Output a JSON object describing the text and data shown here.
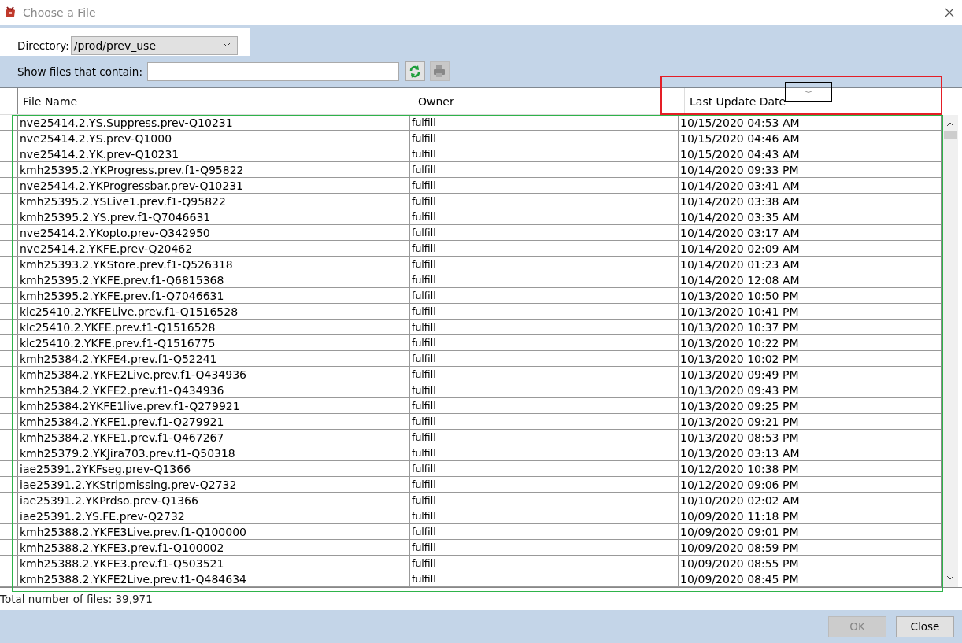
{
  "window": {
    "title": "Choose a File"
  },
  "directory": {
    "label": "Directory:",
    "value": "/prod/prev_use"
  },
  "filter": {
    "label": "Show files that contain:",
    "refresh_disabled": false,
    "print_disabled": true
  },
  "table": {
    "columns": [
      "File Name",
      "Owner",
      "Last Update Date"
    ],
    "rows": [
      [
        "nve25414.2.YS.Suppress.prev-Q10231",
        "fulfill",
        "10/15/2020 04:53 AM"
      ],
      [
        "nve25414.2.YS.prev-Q1000",
        "fulfill",
        "10/15/2020 04:46 AM"
      ],
      [
        "nve25414.2.YK.prev-Q10231",
        "fulfill",
        "10/15/2020 04:43 AM"
      ],
      [
        "kmh25395.2.YKProgress.prev.f1-Q95822",
        "fulfill",
        "10/14/2020 09:33 PM"
      ],
      [
        "nve25414.2.YKProgressbar.prev-Q10231",
        "fulfill",
        "10/14/2020 03:41 AM"
      ],
      [
        "kmh25395.2.YSLive1.prev.f1-Q95822",
        "fulfill",
        "10/14/2020 03:38 AM"
      ],
      [
        "kmh25395.2.YS.prev.f1-Q7046631",
        "fulfill",
        "10/14/2020 03:35 AM"
      ],
      [
        "nve25414.2.YKopto.prev-Q342950",
        "fulfill",
        "10/14/2020 03:17 AM"
      ],
      [
        "nve25414.2.YKFE.prev-Q20462",
        "fulfill",
        "10/14/2020 02:09 AM"
      ],
      [
        "kmh25393.2.YKStore.prev.f1-Q526318",
        "fulfill",
        "10/14/2020 01:23 AM"
      ],
      [
        "kmh25395.2.YKFE.prev.f1-Q6815368",
        "fulfill",
        "10/14/2020 12:08 AM"
      ],
      [
        "kmh25395.2.YKFE.prev.f1-Q7046631",
        "fulfill",
        "10/13/2020 10:50 PM"
      ],
      [
        "klc25410.2.YKFELive.prev.f1-Q1516528",
        "fulfill",
        "10/13/2020 10:41 PM"
      ],
      [
        "klc25410.2.YKFE.prev.f1-Q1516528",
        "fulfill",
        "10/13/2020 10:37 PM"
      ],
      [
        "klc25410.2.YKFE.prev.f1-Q1516775",
        "fulfill",
        "10/13/2020 10:22 PM"
      ],
      [
        "kmh25384.2.YKFE4.prev.f1-Q52241",
        "fulfill",
        "10/13/2020 10:02 PM"
      ],
      [
        "kmh25384.2.YKFE2Live.prev.f1-Q434936",
        "fulfill",
        "10/13/2020 09:49 PM"
      ],
      [
        "kmh25384.2.YKFE2.prev.f1-Q434936",
        "fulfill",
        "10/13/2020 09:43 PM"
      ],
      [
        "kmh25384.2YKFE1live.prev.f1-Q279921",
        "fulfill",
        "10/13/2020 09:25 PM"
      ],
      [
        "kmh25384.2.YKFE1.prev.f1-Q279921",
        "fulfill",
        "10/13/2020 09:21 PM"
      ],
      [
        "kmh25384.2.YKFE1.prev.f1-Q467267",
        "fulfill",
        "10/13/2020 08:53 PM"
      ],
      [
        "kmh25379.2.YKJira703.prev.f1-Q50318",
        "fulfill",
        "10/13/2020 03:13 AM"
      ],
      [
        "iae25391.2YKFseg.prev-Q1366",
        "fulfill",
        "10/12/2020 10:38 PM"
      ],
      [
        "iae25391.2.YKStripmissing.prev-Q2732",
        "fulfill",
        "10/12/2020 09:06 PM"
      ],
      [
        "iae25391.2.YKPrdso.prev-Q1366",
        "fulfill",
        "10/10/2020 02:02 AM"
      ],
      [
        "iae25391.2.YS.FE.prev-Q2732",
        "fulfill",
        "10/09/2020 11:18 PM"
      ],
      [
        "kmh25388.2.YKFE3Live.prev.f1-Q100000",
        "fulfill",
        "10/09/2020 09:01 PM"
      ],
      [
        "kmh25388.2.YKFE3.prev.f1-Q100002",
        "fulfill",
        "10/09/2020 08:59 PM"
      ],
      [
        "kmh25388.2.YKFE3.prev.f1-Q503521",
        "fulfill",
        "10/09/2020 08:55 PM"
      ],
      [
        "kmh25388.2.YKFE2Live.prev.f1-Q484634",
        "fulfill",
        "10/09/2020 08:45 PM"
      ]
    ]
  },
  "status": "Total number of files: 39,971",
  "buttons": [
    {
      "label": "OK",
      "disabled": true
    },
    {
      "label": "Close",
      "disabled": false
    }
  ]
}
